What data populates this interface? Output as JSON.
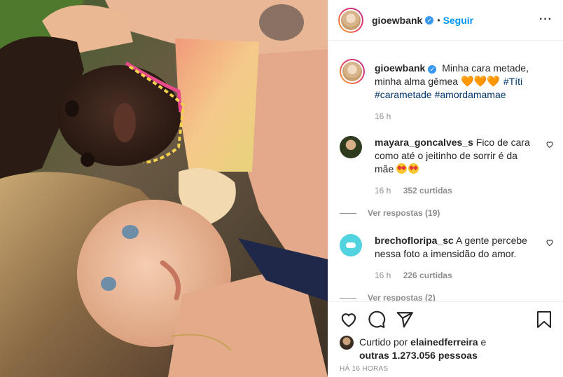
{
  "post": {
    "username": "gioewbank",
    "dot": "•",
    "follow_label": "Seguir",
    "more_icon": "more-horizontal-icon",
    "caption_text": "Minha cara metade, minha alma gêmea",
    "caption_emojis": "🧡🧡🧡",
    "caption_hashtags": "#Títi #carametade #amordamamae",
    "caption_time": "16 h"
  },
  "comments": [
    {
      "username": "mayara_goncalves_s",
      "text": "Fico de cara como até o jeitinho de sorrir é da mãe",
      "time": "16 h",
      "likes": "352 curtidas",
      "replies": "Ver respostas (19)",
      "avatar_color": "#2f3b1f"
    },
    {
      "username": "brechofloripa_sc",
      "text": "A gente percebe nessa foto a imensidão do amor.",
      "time": "16 h",
      "likes": "226 curtidas",
      "replies": "Ver respostas (2)",
      "avatar_color": "#52d3e0"
    }
  ],
  "actions": {
    "liked_prefix": "Curtido por",
    "liked_user": "elainedferreira",
    "liked_suffix": "e",
    "liked_others": "outras 1.273.056 pessoas",
    "time_ago": "HÁ 16 HORAS"
  },
  "colors": {
    "accent": "#0095f6",
    "hashtag": "#00376b",
    "muted": "#8e8e8e",
    "text": "#262626"
  }
}
